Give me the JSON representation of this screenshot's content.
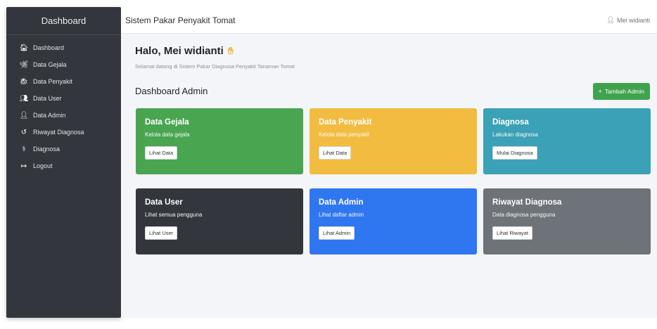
{
  "sidebar": {
    "title": "Dashboard",
    "items": [
      {
        "icon": "home-icon",
        "glyph": "🏠︎",
        "label": "Dashboard"
      },
      {
        "icon": "leaf-icon",
        "glyph": "🌿︎",
        "label": "Data Gejala"
      },
      {
        "icon": "bug-icon",
        "glyph": "🐞︎",
        "label": "Data Penyakit"
      },
      {
        "icon": "users-icon",
        "glyph": "👥︎",
        "label": "Data User"
      },
      {
        "icon": "user-shield-icon",
        "glyph": "👤︎",
        "label": "Data Admin"
      },
      {
        "icon": "history-icon",
        "glyph": "↺",
        "label": "Riwayat Diagnosa"
      },
      {
        "icon": "stethoscope-icon",
        "glyph": "⚕",
        "label": "Diagnosa"
      },
      {
        "icon": "logout-icon",
        "glyph": "↦",
        "label": "Logout"
      }
    ]
  },
  "topbar": {
    "title": "Sistem Pakar Penyakit Tomat",
    "user_icon": "user-icon",
    "user_name": "Mei widianti"
  },
  "main": {
    "greeting": "Halo, Mei widianti",
    "greeting_icon": "waving-hand-icon",
    "subtitle": "Selamat datang di Sistem Pakar Diagnosa Penyakit Tanaman Tomat",
    "section_title": "Dashboard Admin",
    "add_button": "Tambah Admin",
    "add_button_icon": "plus-icon"
  },
  "cards": [
    {
      "title": "Data Gejala",
      "desc": "Kelola data gejala",
      "button": "Lihat Data",
      "color": "#4aa551"
    },
    {
      "title": "Data Penyakit",
      "desc": "Kelola data penyakit",
      "button": "Lihat Data",
      "color": "#f2bc41"
    },
    {
      "title": "Diagnosa",
      "desc": "Lakukan diagnosa",
      "button": "Mulai Diagnosa",
      "color": "#3ba1b6"
    },
    {
      "title": "Data User",
      "desc": "Lihat semua pengguna",
      "button": "Lihat User",
      "color": "#33373d"
    },
    {
      "title": "Data Admin",
      "desc": "Lihat daftar admin",
      "button": "Lihat Admin",
      "color": "#2f77f0"
    },
    {
      "title": "Riwayat Diagnosa",
      "desc": "Data diagnosa pengguna",
      "button": "Lihat Riwayat",
      "color": "#6d7378"
    }
  ]
}
